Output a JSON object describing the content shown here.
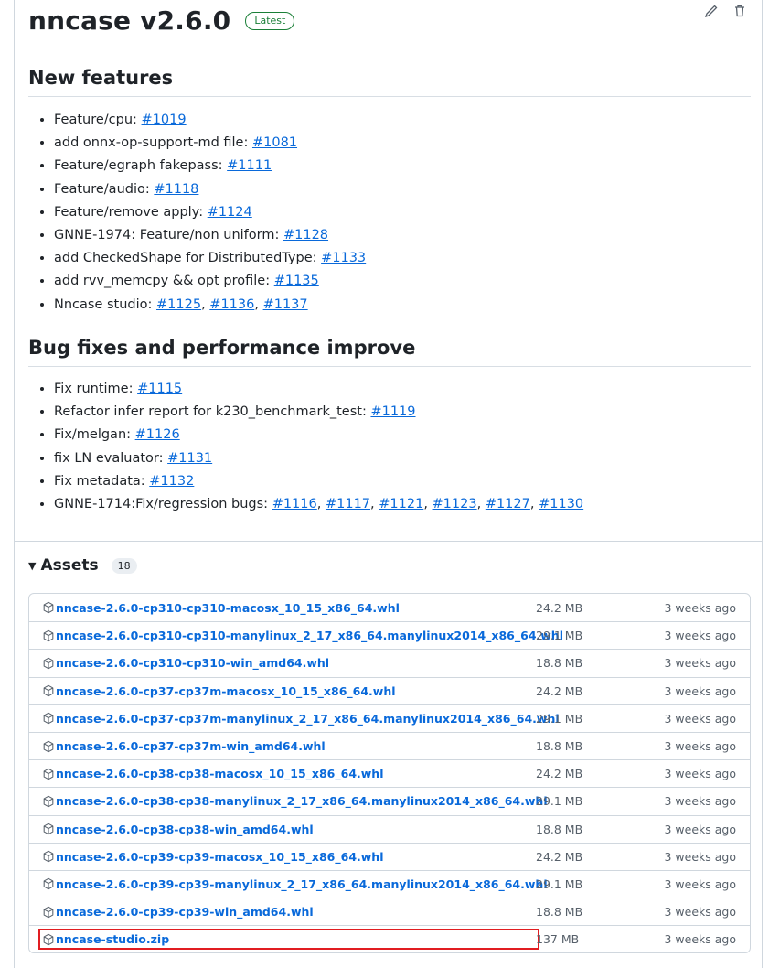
{
  "release": {
    "title": "nncase v2.6.0",
    "badge": "Latest",
    "actions": [
      "pencil-icon",
      "trash-icon"
    ]
  },
  "new_features": {
    "heading": "New features",
    "items": [
      {
        "text": "Feature/cpu: ",
        "links": [
          "#1019"
        ]
      },
      {
        "text": "add onnx-op-support-md file: ",
        "links": [
          "#1081"
        ]
      },
      {
        "text": "Feature/egraph fakepass: ",
        "links": [
          "#1111"
        ]
      },
      {
        "text": "Feature/audio: ",
        "links": [
          "#1118"
        ]
      },
      {
        "text": "Feature/remove apply: ",
        "links": [
          "#1124"
        ]
      },
      {
        "text": "GNNE-1974: Feature/non uniform: ",
        "links": [
          "#1128"
        ]
      },
      {
        "text": "add CheckedShape for DistributedType: ",
        "links": [
          "#1133"
        ]
      },
      {
        "text": "add rvv_memcpy && opt profile: ",
        "links": [
          "#1135"
        ]
      },
      {
        "text": "Nncase studio: ",
        "links": [
          "#1125",
          "#1136",
          "#1137"
        ]
      }
    ]
  },
  "bug_fixes": {
    "heading": "Bug fixes and performance improve",
    "items": [
      {
        "text": "Fix runtime: ",
        "links": [
          "#1115"
        ]
      },
      {
        "text": "Refactor infer report for k230_benchmark_test: ",
        "links": [
          "#1119"
        ]
      },
      {
        "text": "Fix/melgan: ",
        "links": [
          "#1126"
        ]
      },
      {
        "text": "fix LN evaluator: ",
        "links": [
          "#1131"
        ]
      },
      {
        "text": "Fix metadata: ",
        "links": [
          "#1132"
        ]
      },
      {
        "text": "GNNE-1714:Fix/regression bugs: ",
        "links": [
          "#1116",
          "#1117",
          "#1121",
          "#1123",
          "#1127",
          "#1130"
        ]
      }
    ]
  },
  "assets": {
    "title": "Assets",
    "count": "18",
    "rows": [
      {
        "name": "nncase-2.6.0-cp310-cp310-macosx_10_15_x86_64.whl",
        "size": "24.2 MB",
        "date": "3 weeks ago"
      },
      {
        "name": "nncase-2.6.0-cp310-cp310-manylinux_2_17_x86_64.manylinux2014_x86_64.whl",
        "size": "29.1 MB",
        "date": "3 weeks ago"
      },
      {
        "name": "nncase-2.6.0-cp310-cp310-win_amd64.whl",
        "size": "18.8 MB",
        "date": "3 weeks ago"
      },
      {
        "name": "nncase-2.6.0-cp37-cp37m-macosx_10_15_x86_64.whl",
        "size": "24.2 MB",
        "date": "3 weeks ago"
      },
      {
        "name": "nncase-2.6.0-cp37-cp37m-manylinux_2_17_x86_64.manylinux2014_x86_64.whl",
        "size": "29.1 MB",
        "date": "3 weeks ago"
      },
      {
        "name": "nncase-2.6.0-cp37-cp37m-win_amd64.whl",
        "size": "18.8 MB",
        "date": "3 weeks ago"
      },
      {
        "name": "nncase-2.6.0-cp38-cp38-macosx_10_15_x86_64.whl",
        "size": "24.2 MB",
        "date": "3 weeks ago"
      },
      {
        "name": "nncase-2.6.0-cp38-cp38-manylinux_2_17_x86_64.manylinux2014_x86_64.whl",
        "size": "29.1 MB",
        "date": "3 weeks ago"
      },
      {
        "name": "nncase-2.6.0-cp38-cp38-win_amd64.whl",
        "size": "18.8 MB",
        "date": "3 weeks ago"
      },
      {
        "name": "nncase-2.6.0-cp39-cp39-macosx_10_15_x86_64.whl",
        "size": "24.2 MB",
        "date": "3 weeks ago"
      },
      {
        "name": "nncase-2.6.0-cp39-cp39-manylinux_2_17_x86_64.manylinux2014_x86_64.whl",
        "size": "29.1 MB",
        "date": "3 weeks ago"
      },
      {
        "name": "nncase-2.6.0-cp39-cp39-win_amd64.whl",
        "size": "18.8 MB",
        "date": "3 weeks ago"
      },
      {
        "name": "nncase-studio.zip",
        "size": "137 MB",
        "date": "3 weeks ago",
        "highlighted": true
      }
    ]
  },
  "colors": {
    "link": "#0969da",
    "badge": "#1a7f37",
    "highlight": "#e11d21"
  }
}
